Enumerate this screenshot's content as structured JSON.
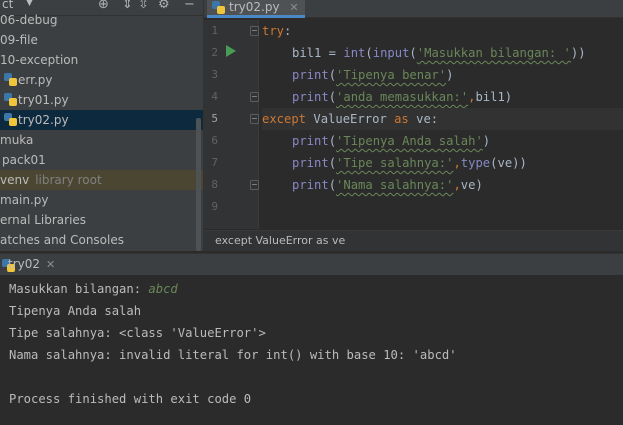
{
  "sidebar": {
    "toolbar_label": "ct",
    "tree": [
      {
        "label": "06-debug",
        "icon": "folder-icon"
      },
      {
        "label": "09-file",
        "icon": "folder-icon"
      },
      {
        "label": "10-exception",
        "icon": "folder-icon"
      },
      {
        "label": "err.py",
        "icon": "python-file-icon"
      },
      {
        "label": "try01.py",
        "icon": "python-file-icon"
      },
      {
        "label": "try02.py",
        "icon": "python-file-icon",
        "selected": true
      },
      {
        "label": "muka",
        "icon": "folder-icon"
      },
      {
        "label": "pack01",
        "icon": "folder-icon"
      },
      {
        "label": "venv",
        "icon": "folder-icon",
        "annotation": "library root"
      },
      {
        "label": "main.py",
        "icon": "python-file-icon"
      },
      {
        "label": "ernal Libraries",
        "icon": "library-icon"
      },
      {
        "label": "atches and Consoles",
        "icon": "scratch-icon"
      }
    ]
  },
  "editor": {
    "tab_label": "try02.py",
    "breadcrumb": "except ValueError as ve",
    "line_numbers": [
      "1",
      "2",
      "3",
      "4",
      "5",
      "6",
      "7",
      "8",
      "9"
    ],
    "current_line": 5,
    "code": {
      "l1_try": "try",
      "l1_colon": ":",
      "l2_var": "bil1 = ",
      "l2_int": "int",
      "l2_p1": "(",
      "l2_input": "input",
      "l2_p2": "(",
      "l2_str": "'Masukkan bilangan: '",
      "l2_end": "))",
      "l3_print": "print",
      "l3_p1": "(",
      "l3_str": "'Tipenya benar'",
      "l3_end": ")",
      "l4_print": "print",
      "l4_p1": "(",
      "l4_str": "'anda memasukkan:'",
      "l4_comma": ",",
      "l4_rest": "bil1)",
      "l5_except": "except",
      "l5_err": " ValueError ",
      "l5_as": "as",
      "l5_rest": " ve:",
      "l6_print": "print",
      "l6_p1": "(",
      "l6_str": "'Tipenya Anda salah'",
      "l6_end": ")",
      "l7_print": "print",
      "l7_p1": "(",
      "l7_str": "'Tipe salahnya:'",
      "l7_comma": ",",
      "l7_type": "type",
      "l7_end": "(ve))",
      "l8_print": "print",
      "l8_p1": "(",
      "l8_str": "'Nama salahnya:'",
      "l8_comma": ",",
      "l8_end": "ve)"
    }
  },
  "run": {
    "tab_label": "try02",
    "output": {
      "prompt": "Masukkan bilangan: ",
      "user_input": "abcd",
      "line2": "Tipenya Anda salah",
      "line3": "Tipe salahnya: <class 'ValueError'>",
      "line4": "Nama salahnya: invalid literal for int() with base 10: 'abcd'",
      "line6": "Process finished with exit code 0"
    }
  },
  "colors": {
    "keyword": "#cc7832",
    "builtin": "#8888c6",
    "string": "#6a8759",
    "selection": "#0d293e",
    "run_marker": "#499c54"
  }
}
